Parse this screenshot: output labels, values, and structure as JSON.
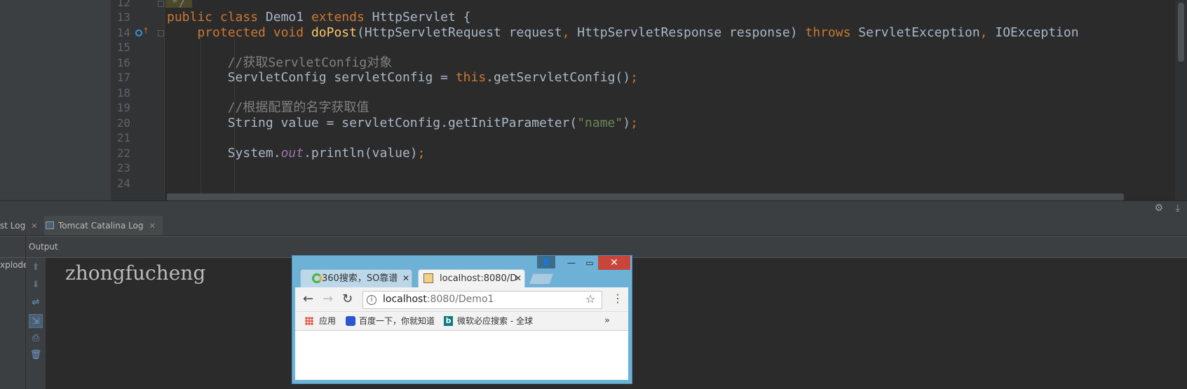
{
  "editor": {
    "line_numbers": [
      "12",
      "13",
      "14",
      "15",
      "16",
      "17",
      "18",
      "19",
      "20",
      "21",
      "22",
      "23",
      "24"
    ],
    "code": {
      "l12": "*/",
      "l13_kw1": "public",
      "l13_kw2": "class",
      "l13_name": "Demo1",
      "l13_kw3": "extends",
      "l13_super": "HttpServlet {",
      "l14_kw1": "protected",
      "l14_kw2": "void",
      "l14_fn": "doPost",
      "l14_p1": "(HttpServletRequest request",
      "l14_comma1": ",",
      "l14_p2": "HttpServletResponse response)",
      "l14_throws": "throws",
      "l14_e1": "ServletException",
      "l14_comma2": ",",
      "l14_e2": "IOException",
      "l16_comment": "//获取ServletConfig对象",
      "l17_a": "ServletConfig servletConfig = ",
      "l17_this": "this",
      "l17_b": ".getServletConfig()",
      "l17_semi": ";",
      "l19_comment": "//根据配置的名字获取值",
      "l20_a": "String value = servletConfig.getInitParameter(",
      "l20_str": "\"name\"",
      "l20_b": ")",
      "l20_semi": ";",
      "l22_a": "System.",
      "l22_field": "out",
      "l22_b": ".println(value)",
      "l22_semi": ";"
    }
  },
  "tool_window": {
    "tabs": [
      {
        "label": "st Log",
        "close": "✕"
      },
      {
        "label": "Tomcat Catalina Log",
        "close": "✕"
      }
    ],
    "output_label": "Output",
    "left_pane_text": "xplode",
    "console_output": "zhongfucheng",
    "icons": {
      "settings": "gear-icon",
      "hide": "hide-icon",
      "toolbar": [
        "up-arrow-icon",
        "down-arrow-icon",
        "soft-wrap-icon",
        "scroll-to-end-icon",
        "print-icon",
        "trash-icon"
      ]
    }
  },
  "browser": {
    "tabs": [
      {
        "label": "360搜索，SO靠谱",
        "close": "✕"
      },
      {
        "label": "localhost:8080/D",
        "close": "✕"
      }
    ],
    "url_host": "localhost",
    "url_rest": ":8080/Demo1",
    "bookmarks": [
      "应用",
      "百度一下，你就知道",
      "微软必应搜索 - 全球"
    ],
    "more_bookmarks": "»",
    "window_controls": {
      "minimize": "—",
      "maximize": "▭",
      "close": "✕"
    },
    "colors": {
      "frame": "#6eb1d6",
      "close": "#c7453a"
    }
  },
  "colors": {
    "editor_bg": "#2b2b2b",
    "keyword": "#cc7832",
    "function": "#ffc66d",
    "string": "#6a8759",
    "comment": "#808080",
    "field": "#9876aa"
  }
}
